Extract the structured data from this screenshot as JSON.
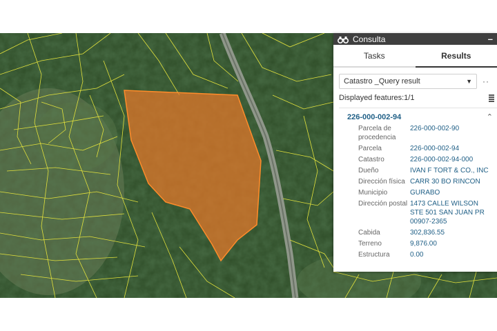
{
  "panel": {
    "title": "Consulta",
    "tabs": [
      {
        "label": "Tasks",
        "active": false
      },
      {
        "label": "Results",
        "active": true
      }
    ],
    "layer_select": "Catastro _Query result",
    "more_label": "··",
    "displayed_features": "Displayed features:1/1",
    "result": {
      "id": "226-000-002-94",
      "attributes": [
        {
          "label": "Parcela de procedencia",
          "value": "226-000-002-90"
        },
        {
          "label": "Parcela",
          "value": "226-000-002-94"
        },
        {
          "label": "Catastro",
          "value": "226-000-002-94-000"
        },
        {
          "label": "Dueño",
          "value": "IVAN F TORT & CO., INC"
        },
        {
          "label": "Dirección física",
          "value": "CARR 30 BO RINCON"
        },
        {
          "label": "Municipio",
          "value": "GURABO"
        },
        {
          "label": "Dirección postal",
          "value": "1473 CALLE WILSON STE 501 SAN JUAN PR 00907-2365"
        },
        {
          "label": "Cabida",
          "value": "302,836.55"
        },
        {
          "label": "Terreno",
          "value": "9,876.00"
        },
        {
          "label": "Estructura",
          "value": "0.00"
        }
      ]
    }
  },
  "colors": {
    "parcel_fill": "#e8782a",
    "parcel_lines": "#e3e23c",
    "result_link": "#1f5f86",
    "titlebar": "#3f3f3f"
  }
}
